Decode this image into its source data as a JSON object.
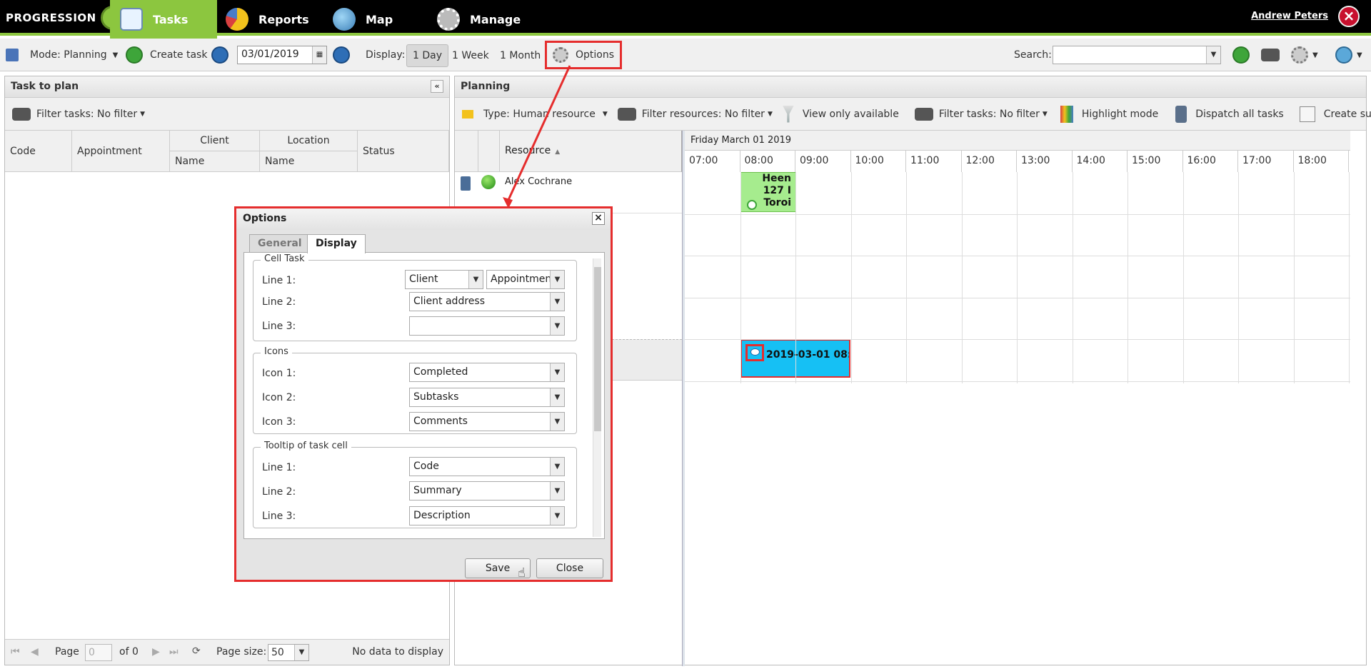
{
  "topnav": {
    "logo_text": "PROGRESSION",
    "tabs": [
      {
        "label": "Tasks",
        "icon": "clipboard-icon",
        "active": true
      },
      {
        "label": "Reports",
        "icon": "pie-chart-icon"
      },
      {
        "label": "Map",
        "icon": "globe-icon"
      },
      {
        "label": "Manage",
        "icon": "gears-icon"
      }
    ],
    "user_name": "Andrew Peters",
    "accent_color": "#8cc63f"
  },
  "toolbar": {
    "mode_label": "Mode: Planning",
    "create_task_label": "Create task",
    "date_value": "03/01/2019",
    "display_label": "Display:",
    "display_options": [
      "1 Day",
      "1 Week",
      "1 Month"
    ],
    "options_label": "Options",
    "search_label": "Search:",
    "search_value": ""
  },
  "left_panel": {
    "title": "Task to plan",
    "filter_label": "Filter tasks: No filter",
    "columns": {
      "code": "Code",
      "appointment": "Appointment",
      "client": "Client",
      "client_name": "Name",
      "location": "Location",
      "location_name": "Name",
      "status": "Status"
    },
    "pager": {
      "page_label": "Page",
      "page_value": "0",
      "of_label": "of 0",
      "page_size_label": "Page size:",
      "page_size_value": "50",
      "status": "No data to display"
    }
  },
  "planning": {
    "title": "Planning",
    "type_label": "Type: Human resource",
    "filter_resources_label": "Filter resources: No filter",
    "view_available_label": "View only available",
    "filter_tasks_label": "Filter tasks: No filter",
    "highlight_label": "Highlight mode",
    "dispatch_label": "Dispatch all tasks",
    "create_subtask_label": "Create subtask",
    "resource_header": "Resource",
    "date_header": "Friday March 01 2019",
    "hours": [
      "07:00",
      "08:00",
      "09:00",
      "10:00",
      "11:00",
      "12:00",
      "13:00",
      "14:00",
      "15:00",
      "16:00",
      "17:00",
      "18:00"
    ],
    "resources": [
      "Alex Cochrane"
    ],
    "task_green_lines": [
      "Heen",
      "127 I",
      "Toroi"
    ],
    "task_blue_text": "2019-03-01 08:("
  },
  "dialog": {
    "title": "Options",
    "tabs": [
      "General",
      "Display"
    ],
    "cell_task": {
      "legend": "Cell Task",
      "line1_label": "Line 1:",
      "line1_value_a": "Client",
      "line1_value_b": "Appointmen",
      "line2_label": "Line 2:",
      "line2_value": "Client address",
      "line3_label": "Line 3:",
      "line3_value": ""
    },
    "icons": {
      "legend": "Icons",
      "icon1_label": "Icon 1:",
      "icon1_value": "Completed",
      "icon2_label": "Icon 2:",
      "icon2_value": "Subtasks",
      "icon3_label": "Icon 3:",
      "icon3_value": "Comments"
    },
    "tooltip": {
      "legend": "Tooltip of task cell",
      "line1_label": "Line 1:",
      "line1_value": "Code",
      "line2_label": "Line 2:",
      "line2_value": "Summary",
      "line3_label": "Line 3:",
      "line3_value": "Description"
    },
    "save_label": "Save",
    "close_label": "Close",
    "highlight_color": "#e52d2d"
  }
}
